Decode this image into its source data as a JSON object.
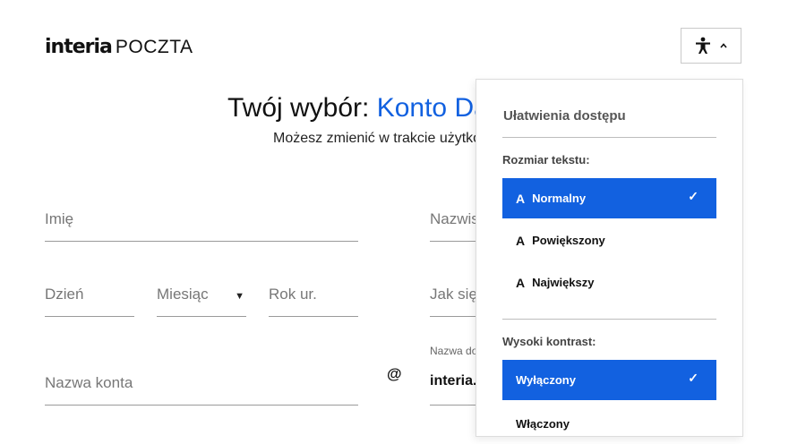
{
  "logo": {
    "brand": "interia",
    "product": "POCZTA"
  },
  "a11y_toggle": {
    "icon": "accessibility-icon",
    "caret": "chevron-up-icon"
  },
  "heading": {
    "prefix": "Twój wybór: ",
    "accent": "Konto Da"
  },
  "subheading": "Możesz zmienić w trakcie użytko",
  "form": {
    "first_name_placeholder": "Imię",
    "last_name_placeholder": "Nazwis",
    "day_placeholder": "Dzień",
    "month_placeholder": "Miesiąc",
    "year_placeholder": "Rok ur.",
    "gender_placeholder": "Jak się",
    "account_placeholder": "Nazwa konta",
    "at_sign": "@",
    "domain_label": "Nazwa do",
    "domain_value": "interia."
  },
  "accessibility_panel": {
    "title": "Ułatwienia dostępu",
    "text_size_label": "Rozmiar tekstu:",
    "text_size_glyph": "A",
    "text_size_options": [
      "Normalny",
      "Powiększony",
      "Największy"
    ],
    "text_size_selected": "Normalny",
    "contrast_label": "Wysoki kontrast:",
    "contrast_options": [
      "Wyłączony",
      "Włączony"
    ],
    "contrast_selected": "Wyłączony",
    "check_mark": "✓"
  },
  "colors": {
    "accent": "#1261e0",
    "text": "#111111",
    "placeholder": "#777777"
  }
}
